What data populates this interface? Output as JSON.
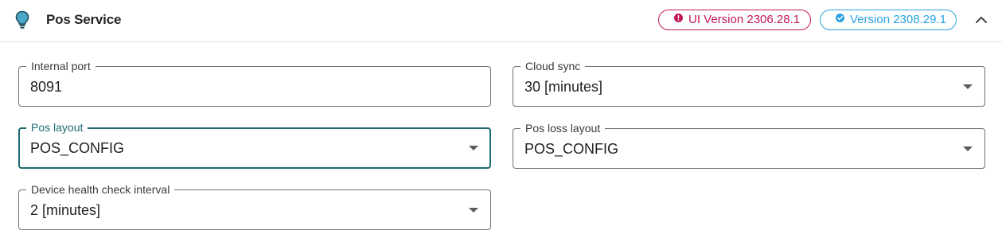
{
  "header": {
    "title": "Pos Service",
    "icon": "lightbulb-icon",
    "ui_version_badge": "UI Version 2306.28.1",
    "version_badge": "Version 2308.29.1",
    "collapse_icon": "chevron-up-icon"
  },
  "colors": {
    "ui_version_badge": "#c2185b",
    "version_badge": "#29a3de",
    "focused_field": "#1f6b73",
    "lightbulb": "#1f6b73"
  },
  "fields": {
    "internal_port": {
      "label": "Internal port",
      "value": "8091"
    },
    "cloud_sync": {
      "label": "Cloud sync",
      "value": "30 [minutes]"
    },
    "pos_layout": {
      "label": "Pos layout",
      "value": "POS_CONFIG"
    },
    "pos_loss_layout": {
      "label": "Pos loss layout",
      "value": "POS_CONFIG"
    },
    "device_health_check_interval": {
      "label": "Device health check interval",
      "value": "2 [minutes]"
    }
  }
}
